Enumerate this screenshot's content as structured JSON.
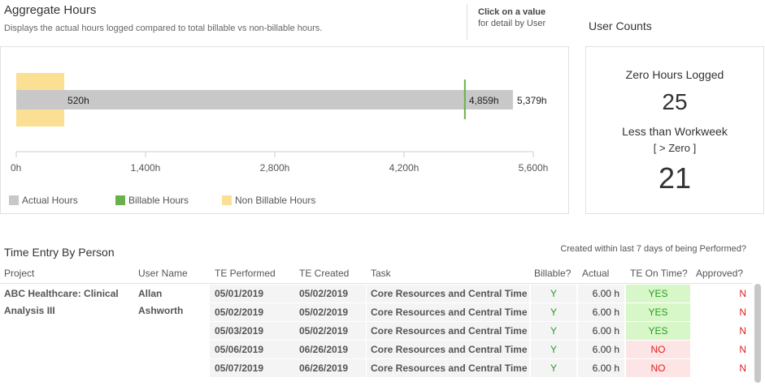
{
  "aggregate": {
    "title": "Aggregate Hours",
    "subtitle": "Displays the actual hours logged compared to total billable vs non-billable hours.",
    "hint_bold": "Click on a value",
    "hint_rest": "for detail by User"
  },
  "chart_data": {
    "type": "bar",
    "orientation": "horizontal",
    "series": [
      {
        "name": "Actual Hours",
        "value": 5379,
        "label": "5,379h",
        "color": "#c8c8c8"
      },
      {
        "name": "Billable Hours",
        "value": 4859,
        "label": "4,859h",
        "color": "#6ab04c"
      },
      {
        "name": "Non Billable Hours",
        "value": 520,
        "label": "520h",
        "color": "#fbdf92"
      }
    ],
    "xlim": [
      0,
      5600
    ],
    "ticks": [
      {
        "value": 0,
        "label": "0h"
      },
      {
        "value": 1400,
        "label": "1,400h"
      },
      {
        "value": 2800,
        "label": "2,800h"
      },
      {
        "value": 4200,
        "label": "4,200h"
      },
      {
        "value": 5600,
        "label": "5,600h"
      }
    ],
    "legend_position": "bottom-left"
  },
  "user_counts": {
    "title": "User Counts",
    "zero_label": "Zero Hours Logged",
    "zero_value": "25",
    "less_label": "Less than Workweek",
    "less_sublabel": "[ > Zero ]",
    "less_value": "21"
  },
  "time_entry": {
    "title": "Time Entry By Person",
    "created_note": "Created within last 7 days of being Performed?",
    "headers": {
      "project": "Project",
      "user": "User Name",
      "te_performed": "TE Performed",
      "te_created": "TE Created",
      "task": "Task",
      "billable": "Billable?",
      "actual": "Actual",
      "on_time": "TE On Time?",
      "approved": "Approved?"
    },
    "project_line1": "ABC Healthcare: Clinical",
    "project_line2": "Analysis III",
    "user_line1": "Allan",
    "user_line2": "Ashworth",
    "rows": [
      {
        "performed": "05/01/2019",
        "created": "05/02/2019",
        "task": "Core Resources and Central Time F",
        "billable": "Y",
        "actual": "6.00 h",
        "on_time": "YES",
        "approved": "N"
      },
      {
        "performed": "05/02/2019",
        "created": "05/02/2019",
        "task": "Core Resources and Central Time F",
        "billable": "Y",
        "actual": "6.00 h",
        "on_time": "YES",
        "approved": "N"
      },
      {
        "performed": "05/03/2019",
        "created": "05/02/2019",
        "task": "Core Resources and Central Time F",
        "billable": "Y",
        "actual": "6.00 h",
        "on_time": "YES",
        "approved": "N"
      },
      {
        "performed": "05/06/2019",
        "created": "06/26/2019",
        "task": "Core Resources and Central Time F",
        "billable": "Y",
        "actual": "6.00 h",
        "on_time": "NO",
        "approved": "N"
      },
      {
        "performed": "05/07/2019",
        "created": "06/26/2019",
        "task": "Core Resources and Central Time F",
        "billable": "Y",
        "actual": "6.00 h",
        "on_time": "NO",
        "approved": "N"
      }
    ]
  }
}
